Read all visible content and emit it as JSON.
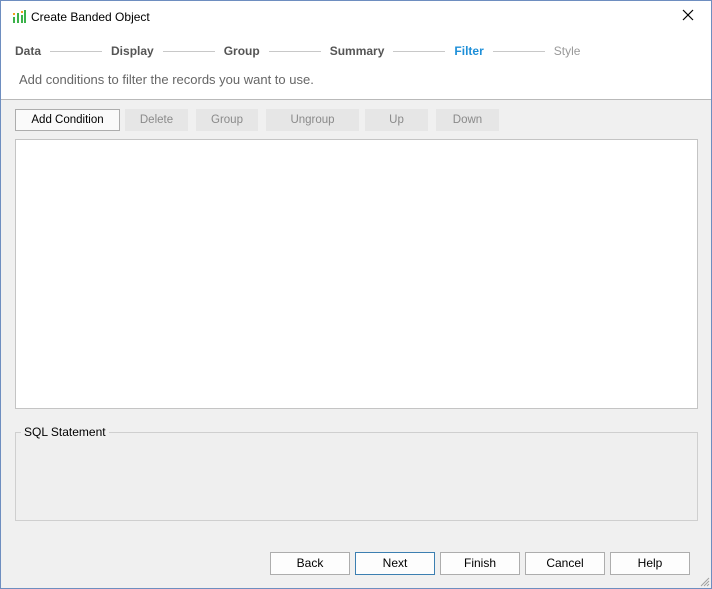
{
  "window": {
    "title": "Create Banded Object",
    "icon": "banded-object-icon",
    "close_icon": "close-icon"
  },
  "steps": [
    {
      "label": "Data",
      "state": "done"
    },
    {
      "label": "Display",
      "state": "done"
    },
    {
      "label": "Group",
      "state": "done"
    },
    {
      "label": "Summary",
      "state": "done"
    },
    {
      "label": "Filter",
      "state": "active"
    },
    {
      "label": "Style",
      "state": "future"
    }
  ],
  "subtitle": "Add conditions to filter the records you want to use.",
  "toolbar": {
    "add_condition": "Add Condition",
    "delete": "Delete",
    "group": "Group",
    "ungroup": "Ungroup",
    "up": "Up",
    "down": "Down"
  },
  "sql": {
    "legend": "SQL Statement",
    "value": ""
  },
  "buttons": {
    "back": "Back",
    "next": "Next",
    "finish": "Finish",
    "cancel": "Cancel",
    "help": "Help"
  },
  "colors": {
    "active_step": "#1e8fd8",
    "window_border": "#6e8ec0",
    "icon_green": "#3cb24a"
  }
}
